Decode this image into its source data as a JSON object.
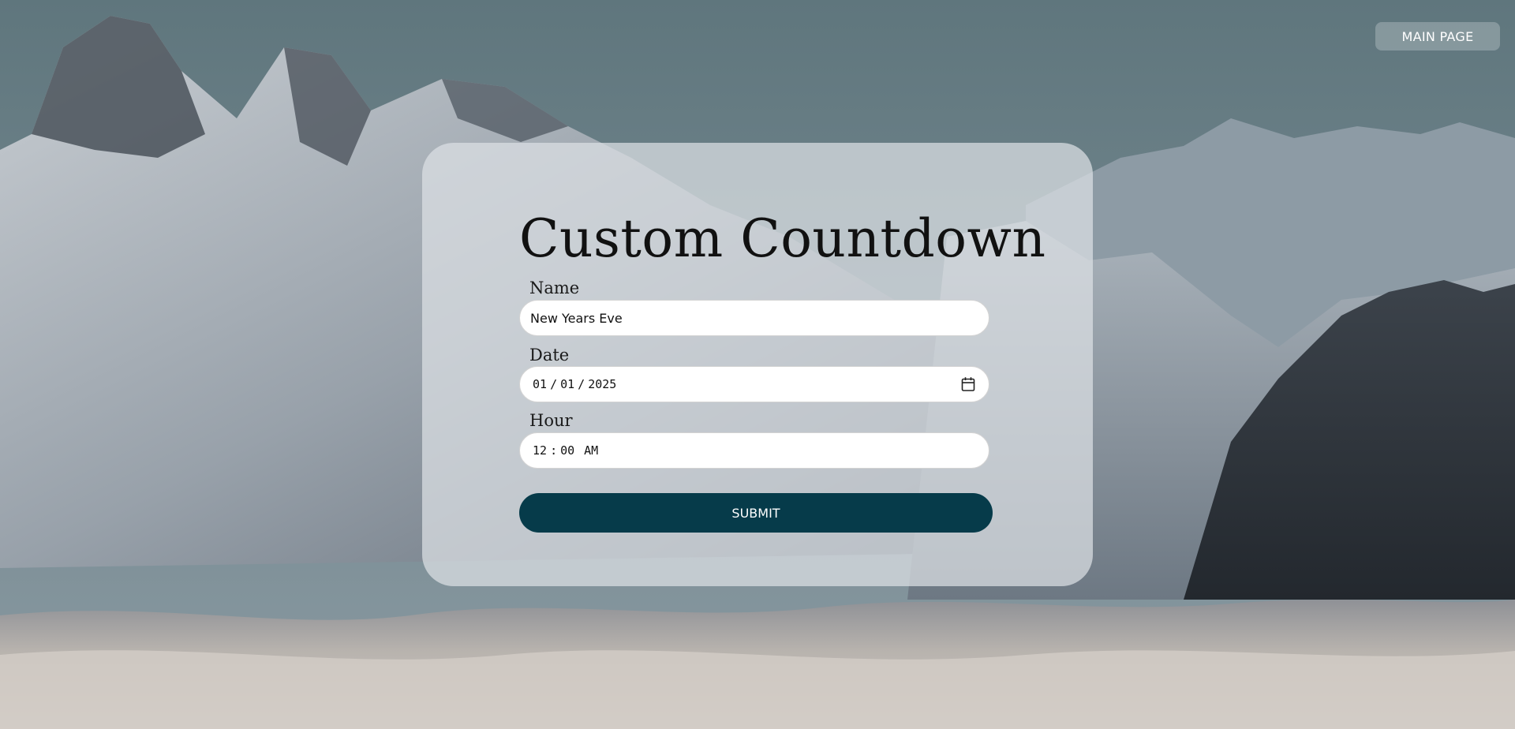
{
  "header": {
    "main_page_label": "MAIN PAGE"
  },
  "form": {
    "title": "Custom Countdown",
    "name": {
      "label": "Name",
      "value": "New Years Eve"
    },
    "date": {
      "label": "Date",
      "month": "01",
      "day": "01",
      "year": "2025",
      "separator": "/",
      "icon": "calendar-icon"
    },
    "hour": {
      "label": "Hour",
      "hours": "12",
      "minutes": "00",
      "separator": ":",
      "period": "AM"
    },
    "submit_label": "SUBMIT"
  },
  "colors": {
    "submit_background": "#063b4a",
    "card_background": "rgba(220,224,228,0.72)"
  }
}
